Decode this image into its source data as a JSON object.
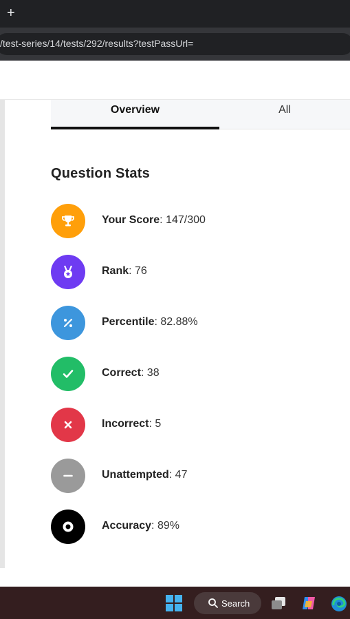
{
  "browser": {
    "new_tab_symbol": "+",
    "address": "/test-series/14/tests/292/results?testPassUrl="
  },
  "tabs": {
    "overview": "Overview",
    "all": "All"
  },
  "section_title": "Question Stats",
  "stats": [
    {
      "label": "Your Score",
      "sep": ": ",
      "value": "147/300",
      "icon": "trophy-icon",
      "color": "#ff9f0a"
    },
    {
      "label": "Rank",
      "sep": ": ",
      "value": "76",
      "icon": "medal-icon",
      "color": "#6e3bf2"
    },
    {
      "label": "Percentile",
      "sep": ": ",
      "value": "82.88%",
      "icon": "percent-icon",
      "color": "#3d96dd"
    },
    {
      "label": "Correct",
      "sep": ": ",
      "value": "38",
      "icon": "check-icon",
      "color": "#22bd67"
    },
    {
      "label": "Incorrect",
      "sep": ": ",
      "value": "5",
      "icon": "cross-icon",
      "color": "#e23748"
    },
    {
      "label": "Unattempted",
      "sep": ": ",
      "value": "47",
      "icon": "minus-icon",
      "color": "#9a9a9a"
    },
    {
      "label": "Accuracy",
      "sep": ": ",
      "value": "89%",
      "icon": "target-icon",
      "color": "#000000"
    }
  ],
  "taskbar": {
    "search_label": "Search"
  }
}
